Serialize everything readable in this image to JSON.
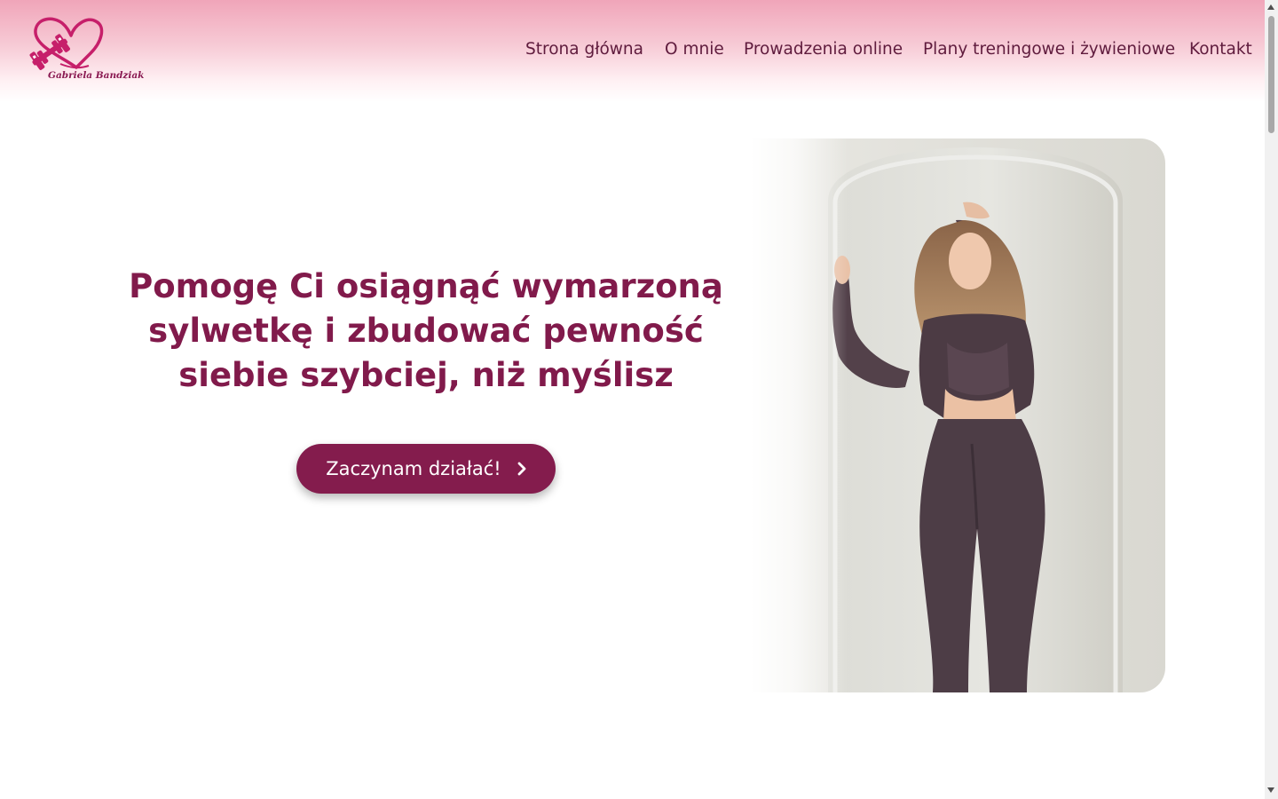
{
  "brand": {
    "logo_text": "Gabriela Bandziak",
    "logo_icon": "heart-dumbbell-icon",
    "primary_color": "#841c4d",
    "title_color": "#811a4b",
    "nav_color": "#5f1b3d",
    "header_top_color": "#f0a5b9"
  },
  "nav": {
    "items": [
      {
        "label": "Strona główna"
      },
      {
        "label": "O mnie"
      },
      {
        "label": "Prowadzenia online"
      },
      {
        "label": "Plany treningowe i żywieniowe"
      },
      {
        "label": "Kontakt"
      }
    ]
  },
  "hero": {
    "title": "Pomogę Ci osiągnąć wymarzoną sylwetkę i zbudować pewność siebie szybciej, niż myślisz",
    "cta_label": "Zaczynam działać!",
    "cta_icon": "chevron-right-icon"
  }
}
